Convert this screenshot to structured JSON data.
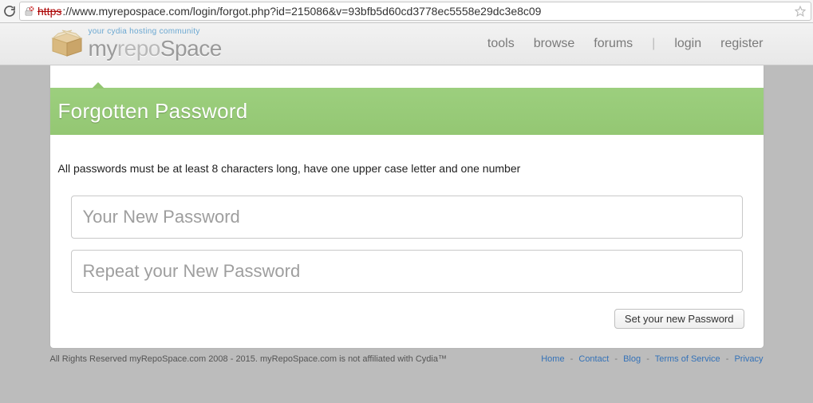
{
  "browser": {
    "url_https": "https",
    "url_rest": "://www.myrepospace.com/login/forgot.php?id=215086&v=93bfb5d60cd3778ec5558e29dc3e8c09"
  },
  "header": {
    "tagline": "your cydia hosting community",
    "brand_a": "my",
    "brand_b": "repo",
    "brand_c": "Space",
    "nav": {
      "tools": "tools",
      "browse": "browse",
      "forums": "forums",
      "login": "login",
      "register": "register"
    }
  },
  "main": {
    "title": "Forgotten Password",
    "rule": "All passwords must be at least 8 characters long, have one upper case letter and one number",
    "pw1_placeholder": "Your New Password",
    "pw2_placeholder": "Repeat your New Password",
    "submit": "Set your new Password"
  },
  "footer": {
    "copyright": "All Rights Reserved myRepoSpace.com 2008 - 2015. myRepoSpace.com is not affiliated with Cydia™",
    "links": {
      "home": "Home",
      "contact": "Contact",
      "blog": "Blog",
      "tos": "Terms of Service",
      "privacy": "Privacy"
    }
  }
}
